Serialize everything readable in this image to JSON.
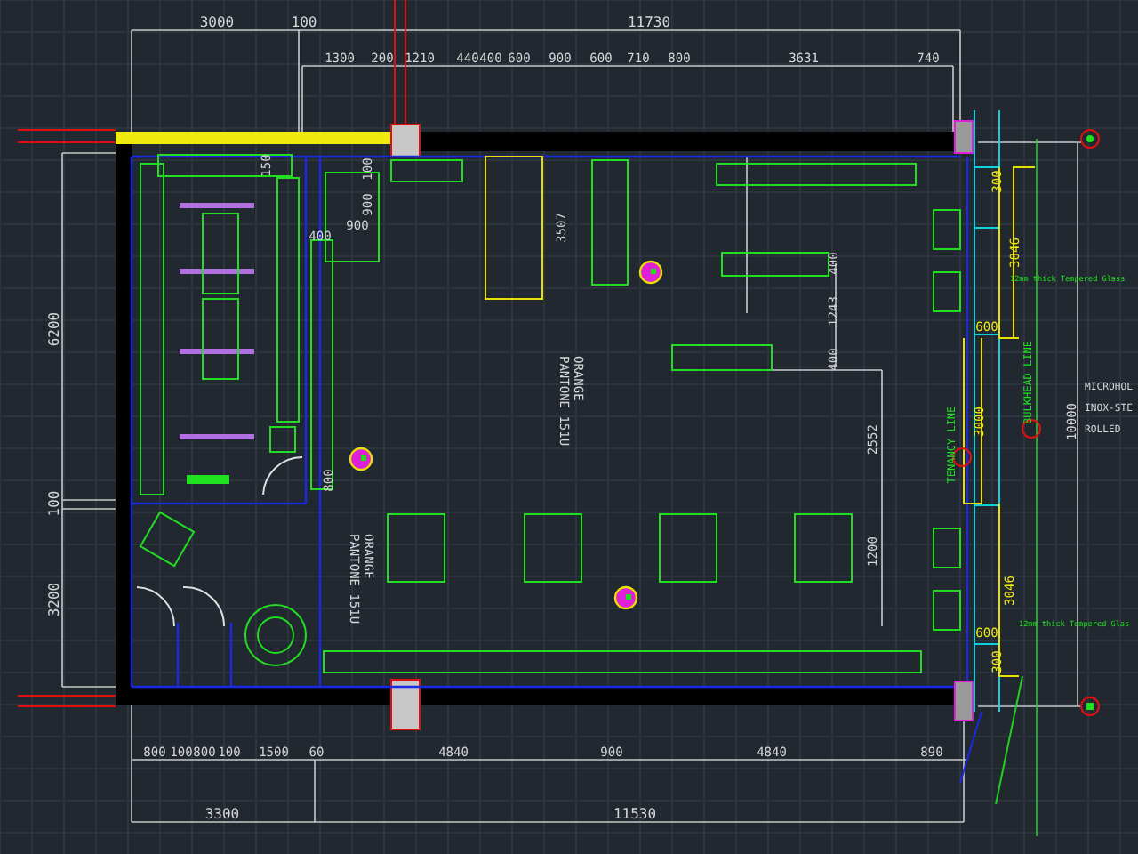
{
  "drawing": {
    "top_overall": [
      "3000",
      "100",
      "11730"
    ],
    "top_detail": [
      "1300",
      "200",
      "1210",
      "440",
      "400",
      "600",
      "900",
      "600",
      "710",
      "800",
      "3631",
      "740"
    ],
    "bottom_detail": [
      "800",
      "100",
      "800",
      "100",
      "1500",
      "60",
      "4840",
      "900",
      "4840",
      "890"
    ],
    "bottom_overall": [
      "3300",
      "11530"
    ],
    "left_dimensions": [
      "6200",
      "100",
      "3200"
    ],
    "interior_dimensions": [
      "150",
      "100",
      "900",
      "400",
      "900",
      "800",
      "3507",
      "400",
      "1243",
      "400",
      "2552",
      "1200"
    ],
    "right_dimensions": [
      "300",
      "3046",
      "600",
      "3000",
      "3046",
      "600",
      "300",
      "10000"
    ],
    "colour_notes": [
      {
        "lines": [
          "ORANGE",
          "PANTONE 151U"
        ]
      },
      {
        "lines": [
          "ORANGE",
          "PANTONE 151U"
        ]
      }
    ],
    "glass_notes": [
      "12mm thick Tempered Glass",
      "12mm thick Tempered Glas"
    ],
    "line_labels": [
      "BULKHEAD LINE",
      "TENANCY LINE"
    ],
    "side_note": [
      "MICROHOL",
      "INOX-STE",
      "ROLLED"
    ]
  }
}
